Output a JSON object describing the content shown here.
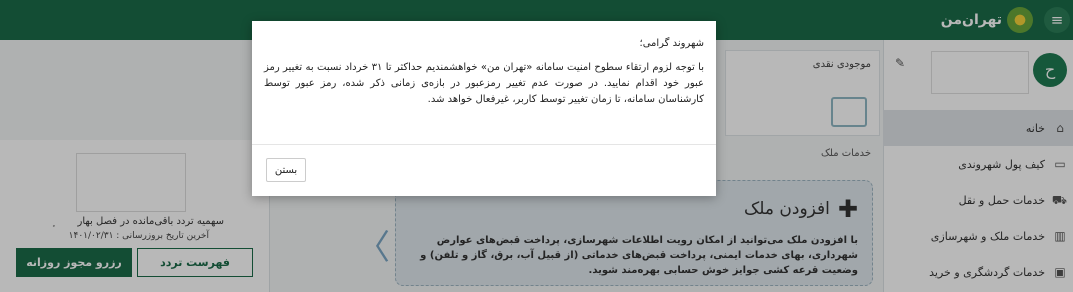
{
  "header": {
    "logo_text": "تهران‌من",
    "menu_icon": "hamburger-icon"
  },
  "sidebar": {
    "avatar_letter": "ح",
    "items": [
      {
        "label": "خانه",
        "icon": "home-icon",
        "active": true
      },
      {
        "label": "کیف پول شهروندی",
        "icon": "wallet-icon",
        "active": false
      },
      {
        "label": "خدمات حمل و نقل",
        "icon": "car-icon",
        "active": false
      },
      {
        "label": "خدمات ملک و شهرسازی",
        "icon": "building-icon",
        "active": false
      },
      {
        "label": "خدمات گردشگری و خرید",
        "icon": "bag-icon",
        "active": false
      }
    ]
  },
  "wallet": {
    "title": "موجودی نقدی"
  },
  "services": {
    "title": "خدمات ملک",
    "add_title": "افزودن ملک",
    "add_desc": "با افزودن ملک می‌توانید از امکان رویت اطلاعات شهرسازی، پرداخت قبض‌های عوارض شهرداری، بهای خدمات ایمنی، پرداخت قبض‌های خدماتی (از قبیل آب، برق، گاز و تلفن) و وضعیت قرعه کشی جوایز خوش حسابی بهره‌مند شوید."
  },
  "quota": {
    "remaining_text": "سهمیه تردد باقی‌مانده در فصل بهار : روز",
    "updated_text": "آخرین تاریخ بروزرسانی : ۱۴۰۱/۰۲/۳۱",
    "reserve_button": "رزرو مجوز روزانه",
    "list_button": "فهرست تردد"
  },
  "modal": {
    "title": "شهروند گرامی؛",
    "body": "با توجه لزوم ارتقاء سطوح امنیت سامانه «تهران من» خواهشمندیم حداکثر تا ۳۱ خرداد نسبت به تغییر رمز عبور خود اقدام نمایید. در صورت عدم تغییر رمزعبور در بازه‌ی زمانی ذکر شده، رمز عبور توسط کارشناسان سامانه، تا زمان تغییر توسط کاربر، غیرفعال خواهد شد.",
    "close_label": "بستن"
  }
}
